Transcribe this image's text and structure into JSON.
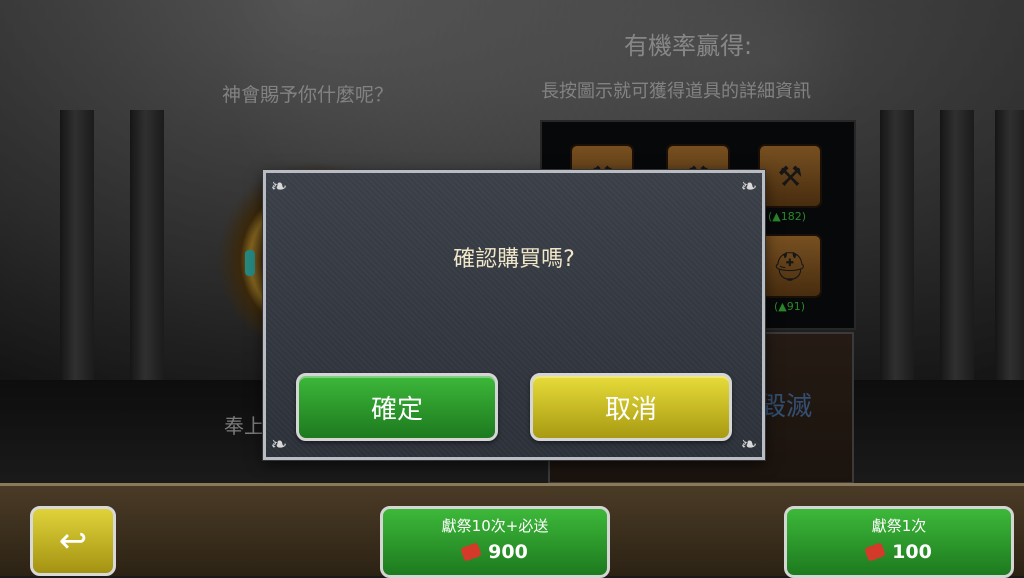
{
  "background": {
    "god_question": "神會賜予你什麼呢？",
    "offer_text": "奉上",
    "destroy_label": "毀滅"
  },
  "reward_panel": {
    "title": "有機率贏得:",
    "hint": "長按圖示就可獲得道具的詳細資訊",
    "items": [
      {
        "icon": "axe-icon",
        "stat": ""
      },
      {
        "icon": "axe-icon",
        "stat": ""
      },
      {
        "icon": "axe-icon",
        "stat": "(▲182)"
      },
      {
        "icon": "helmet-icon",
        "stat": "(▲91)"
      }
    ]
  },
  "dialog": {
    "title": "確認購買嗎?",
    "confirm_label": "確定",
    "cancel_label": "取消"
  },
  "bottom_bar": {
    "back_icon": "back-arrow-icon",
    "offer10": {
      "label": "獻祭10次+必送",
      "cost": "900",
      "currency_icon": "ruby-icon"
    },
    "offer1": {
      "label": "獻祭1次",
      "cost": "100",
      "currency_icon": "ruby-icon"
    }
  },
  "colors": {
    "green_button": "#2a9a2a",
    "yellow_button": "#c9ba22",
    "dialog_bg": "#343942",
    "destroy_text": "#4e78b0"
  }
}
